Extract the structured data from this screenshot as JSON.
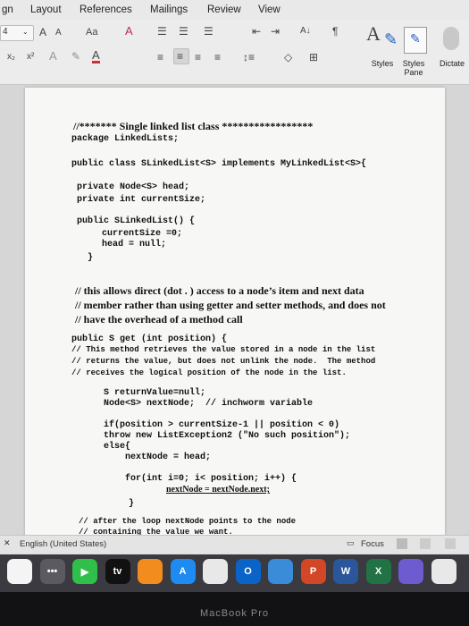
{
  "ribbon_tabs": [
    "gn",
    "Layout",
    "References",
    "Mailings",
    "Review",
    "View"
  ],
  "ribbon": {
    "font_size_value": "4",
    "grow_font": "A",
    "shrink_font": "A",
    "change_case": "Aa",
    "clear_format": "A",
    "subscript": "x₂",
    "superscript": "x²",
    "highlight": "A",
    "font_color": "A",
    "sort": "A↓",
    "pilcrow": "¶",
    "styles_label": "Styles",
    "styles_pane_label": "Styles\nPane",
    "dictate_label": "Dictate"
  },
  "document": {
    "lines": [
      {
        "id": "l1",
        "style": "serif",
        "text": "//******* Single linked list class *****************"
      },
      {
        "id": "l2",
        "style": "mono",
        "text": "package LinkedLists;"
      },
      {
        "id": "l3",
        "style": "mono",
        "text": "public class SLinkedList<S> implements MyLinkedList<S>{"
      },
      {
        "id": "l4",
        "style": "mono",
        "text": "private Node<S> head;"
      },
      {
        "id": "l5",
        "style": "mono",
        "text": "private int currentSize;"
      },
      {
        "id": "l6",
        "style": "mono",
        "text": "public SLinkedList() {"
      },
      {
        "id": "l7",
        "style": "mono",
        "text": "currentSize =0;"
      },
      {
        "id": "l8",
        "style": "mono",
        "text": "head = null;"
      },
      {
        "id": "l9",
        "style": "mono",
        "text": "}"
      },
      {
        "id": "l10",
        "style": "serif",
        "text": "// this allows direct (dot . ) access to a node’s item and next data"
      },
      {
        "id": "l11",
        "style": "serif",
        "text": "// member rather than using getter and setter methods, and does not"
      },
      {
        "id": "l12",
        "style": "serif",
        "text": "// have the overhead of a method call"
      },
      {
        "id": "l13",
        "style": "mono",
        "text": "public S get (int position) {"
      },
      {
        "id": "l14",
        "style": "mono",
        "text": "// This method retrieves the value stored in a node in the list"
      },
      {
        "id": "l15",
        "style": "mono",
        "text": "// returns the value, but does not unlink the node.  The method"
      },
      {
        "id": "l16",
        "style": "mono",
        "text": "// receives the logical position of the node in the list."
      },
      {
        "id": "l17",
        "style": "mono",
        "text": "S returnValue=null;"
      },
      {
        "id": "l18",
        "style": "mono",
        "text": "Node<S> nextNode;  // inchworm variable"
      },
      {
        "id": "l19",
        "style": "mono",
        "text": "if(position > currentSize-1 || position < 0)"
      },
      {
        "id": "l20",
        "style": "mono",
        "text": "throw new ListException2 (\"No such position\");"
      },
      {
        "id": "l21",
        "style": "mono",
        "text": "else{"
      },
      {
        "id": "l22",
        "style": "mono",
        "text": "nextNode = head;"
      },
      {
        "id": "l23",
        "style": "mono",
        "text": "for(int i=0; i< position; i++) {"
      },
      {
        "id": "l24",
        "style": "serif",
        "text": "nextNode = nextNode.next;"
      },
      {
        "id": "l25",
        "style": "mono",
        "text": "}"
      },
      {
        "id": "l26",
        "style": "mono",
        "text": "// after the loop nextNode points to the node"
      },
      {
        "id": "l27",
        "style": "mono",
        "text": "// containing the value we want."
      }
    ]
  },
  "status_bar": {
    "language": "English (United States)",
    "focus_label": "Focus"
  },
  "dock": {
    "apps": [
      {
        "name": "photos",
        "label": "",
        "color": "#f4f4f4"
      },
      {
        "name": "more",
        "label": "•••",
        "color": "#5a5a60"
      },
      {
        "name": "facetime",
        "label": "▶",
        "color": "#2fbf4a"
      },
      {
        "name": "appletv",
        "label": "tv",
        "color": "#111111"
      },
      {
        "name": "books",
        "label": "",
        "color": "#f28c1e"
      },
      {
        "name": "appstore",
        "label": "A",
        "color": "#1f8bf0"
      },
      {
        "name": "teams",
        "label": "",
        "color": "#e8e8e8"
      },
      {
        "name": "outlook",
        "label": "O",
        "color": "#0a64c8"
      },
      {
        "name": "maps",
        "label": "",
        "color": "#3a8bd8"
      },
      {
        "name": "powerpoint",
        "label": "P",
        "color": "#d24726"
      },
      {
        "name": "word",
        "label": "W",
        "color": "#2b579a"
      },
      {
        "name": "excel",
        "label": "X",
        "color": "#217346"
      },
      {
        "name": "mirror",
        "label": "",
        "color": "#6d5bd0"
      },
      {
        "name": "doc",
        "label": "",
        "color": "#e8e8e8"
      }
    ]
  },
  "hardware_label": "MacBook Pro"
}
